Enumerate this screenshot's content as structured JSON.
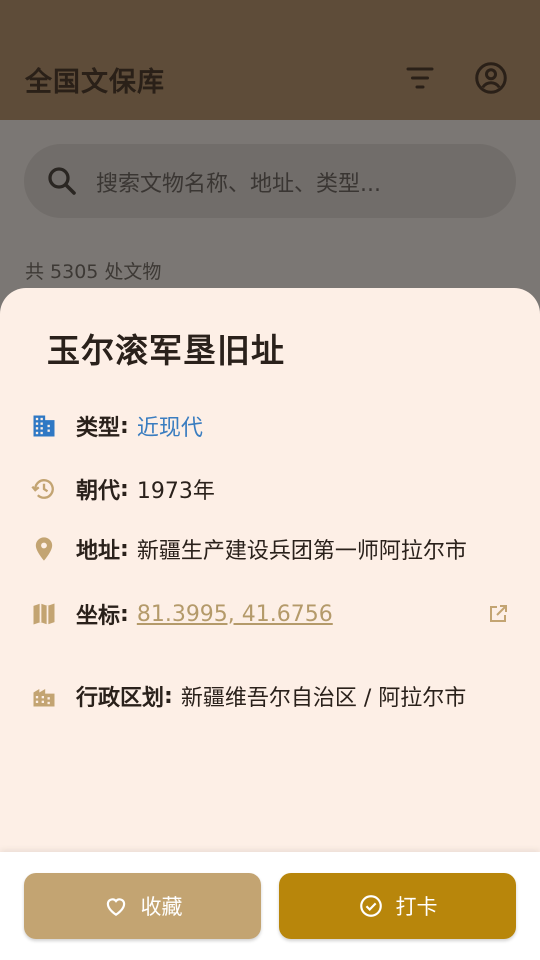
{
  "app": {
    "title": "全国文保库",
    "icons": {
      "filter": "filter-icon",
      "account": "account-circle-icon"
    }
  },
  "search": {
    "placeholder": "搜索文物名称、地址、类型..."
  },
  "list": {
    "count_text": "共 5305 处文物"
  },
  "sheet": {
    "title": "玉尔滚军垦旧址",
    "rows": [
      {
        "label": "类型",
        "value": "近现代",
        "icon": "building-icon",
        "value_color": "#3a7dc0"
      },
      {
        "label": "朝代",
        "value": "1973年",
        "icon": "history-icon"
      },
      {
        "label": "地址",
        "value": "新疆生产建设兵团第一师阿拉尔市",
        "icon": "location-pin-icon"
      },
      {
        "label": "坐标",
        "value": "81.3995, 41.6756",
        "icon": "map-icon"
      },
      {
        "label": "行政区划",
        "value": "新疆维吾尔自治区 / 阿拉尔市",
        "icon": "city-icon"
      }
    ],
    "colon": ":"
  },
  "actions": {
    "favorite_label": "收藏",
    "checkin_label": "打卡"
  },
  "colors": {
    "accent": "#b8860b",
    "favorite_button": "#c3a472",
    "sheet_bg": "#fdefe6",
    "link": "#3a7dc0",
    "icon_tan": "#c3a472",
    "icon_blue": "#2f78c4"
  }
}
